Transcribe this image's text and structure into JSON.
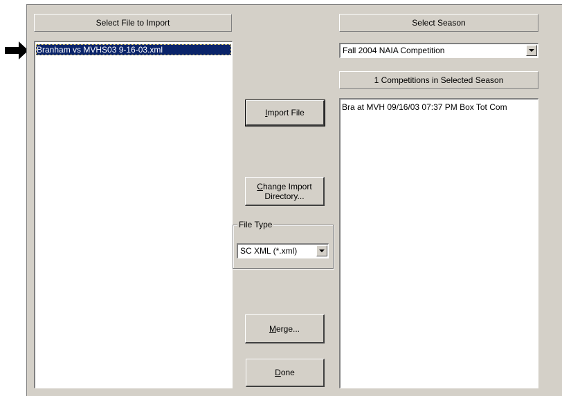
{
  "left_header": "Select File to Import",
  "files": [
    "Branham vs MVHS03 9-16-03.xml"
  ],
  "season_header": "Select Season",
  "season_value": "Fall 2004 NAIA Competition",
  "competitions_header": "1 Competitions in Selected Season",
  "competitions": [
    "Bra at MVH 09/16/03 07:37 PM  Box Tot Com"
  ],
  "buttons": {
    "import_mn": "I",
    "import_rest": "mport File",
    "change_mn": "C",
    "change_rest": "hange Import",
    "change_line2": "Directory...",
    "merge_mn": "M",
    "merge_rest": "erge...",
    "done_mn": "D",
    "done_rest": "one"
  },
  "file_type_label": "File Type",
  "file_type_value": "SC XML (*.xml)",
  "colors": {
    "selection": "#0a246a",
    "dialog": "#d4d0c8"
  }
}
